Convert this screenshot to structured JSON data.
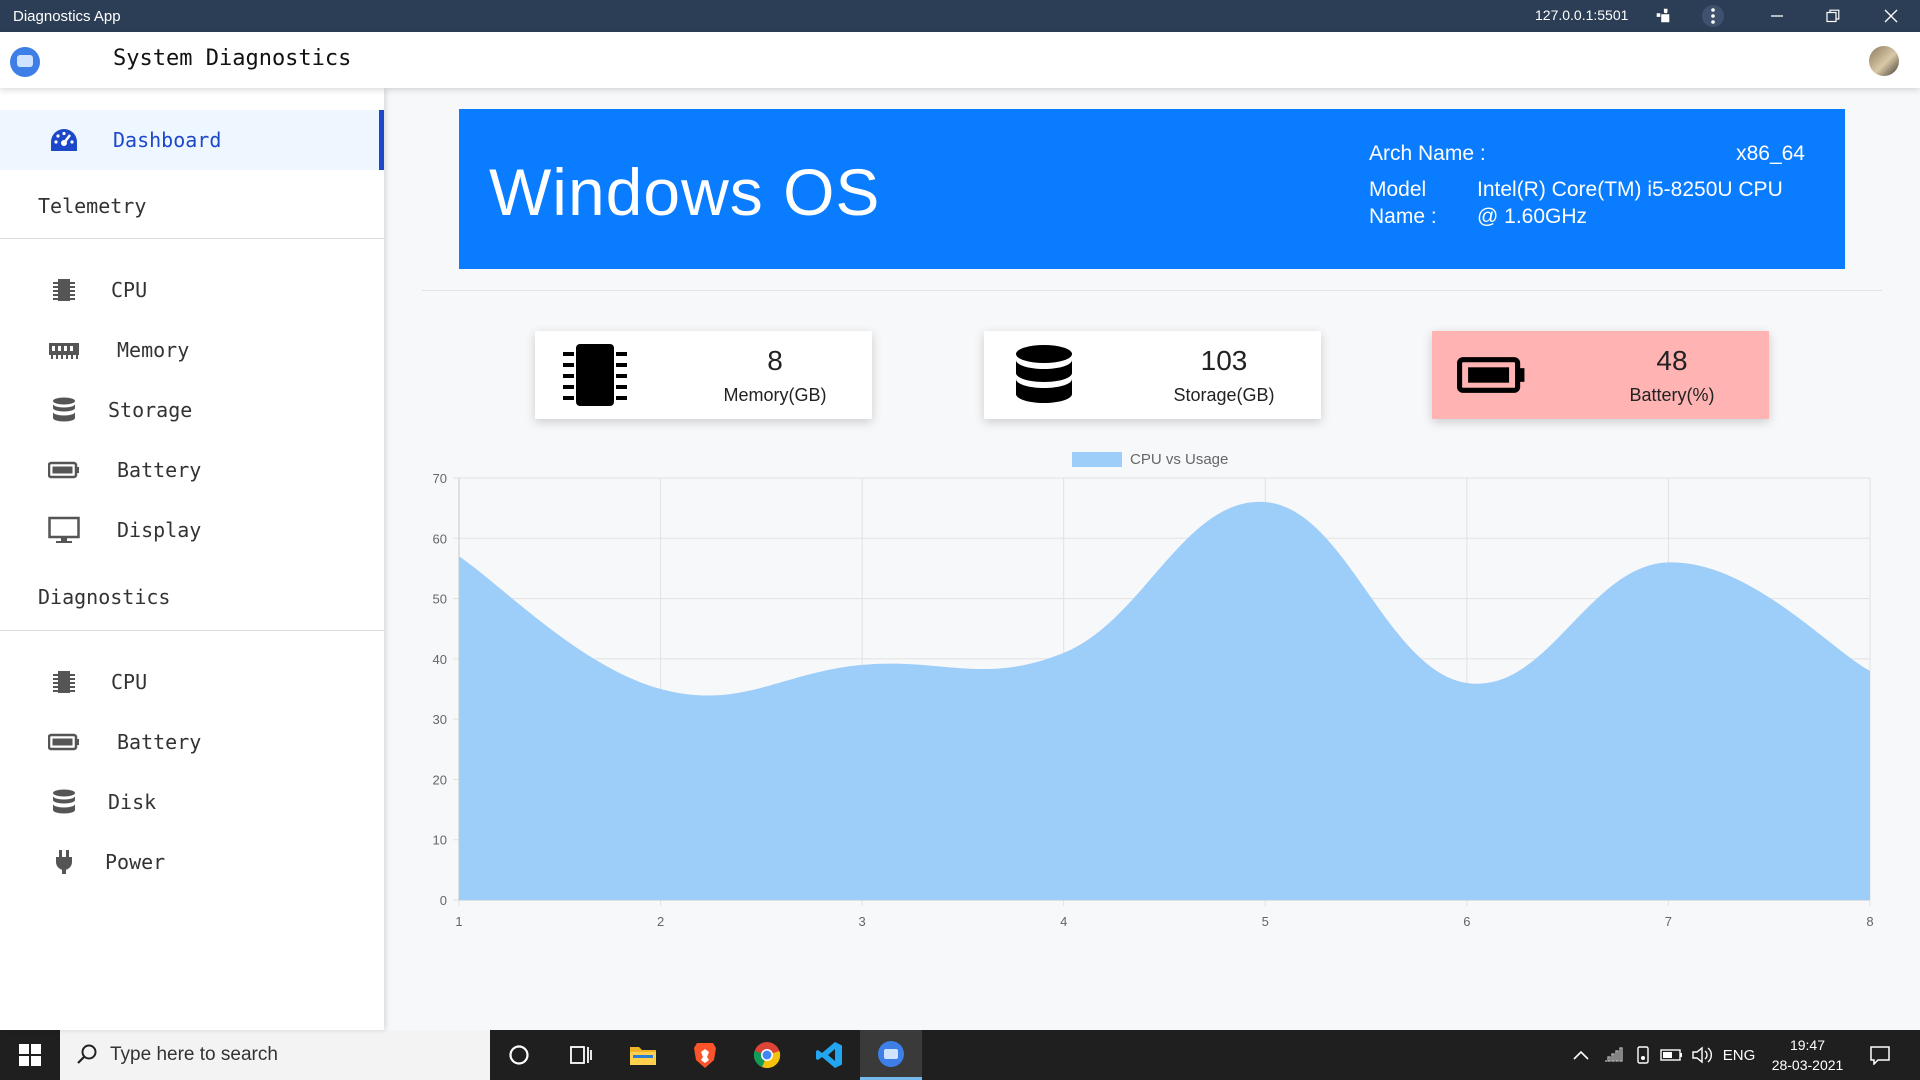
{
  "titlebar": {
    "title": "Diagnostics App",
    "url": "127.0.0.1:5501"
  },
  "app": {
    "title": "System Diagnostics"
  },
  "sidebar": {
    "dashboard_label": "Dashboard",
    "telemetry_heading": "Telemetry",
    "telemetry_items": [
      {
        "label": "CPU",
        "icon": "chip-icon"
      },
      {
        "label": "Memory",
        "icon": "memory-icon"
      },
      {
        "label": "Storage",
        "icon": "database-icon"
      },
      {
        "label": "Battery",
        "icon": "battery-icon"
      },
      {
        "label": "Display",
        "icon": "monitor-icon"
      }
    ],
    "diagnostics_heading": "Diagnostics",
    "diagnostics_items": [
      {
        "label": "CPU",
        "icon": "chip-icon"
      },
      {
        "label": "Battery",
        "icon": "battery-icon"
      },
      {
        "label": "Disk",
        "icon": "database-icon"
      },
      {
        "label": "Power",
        "icon": "plug-icon"
      }
    ]
  },
  "banner": {
    "os": "Windows OS",
    "arch_label": "Arch Name :",
    "arch_value": "x86_64",
    "model_label_1": "Model",
    "model_label_2": "Name :",
    "model_value_1": "Intel(R) Core(TM) i5-8250U CPU",
    "model_value_2": "@ 1.60GHz",
    "color": "#0a7cff"
  },
  "cards": [
    {
      "value": "8",
      "label": "Memory(GB)",
      "icon": "chip-icon"
    },
    {
      "value": "103",
      "label": "Storage(GB)",
      "icon": "database-icon"
    },
    {
      "value": "48",
      "label": "Battery(%)",
      "icon": "battery-icon",
      "color": "#ffb3b3"
    }
  ],
  "chart_data": {
    "type": "area",
    "legend": "CPU vs Usage",
    "x": [
      1,
      2,
      3,
      4,
      5,
      6,
      7,
      8
    ],
    "values": [
      57,
      35,
      39,
      41,
      66,
      36,
      56,
      38
    ],
    "ylim": [
      0,
      70
    ],
    "yticks": [
      0,
      10,
      20,
      30,
      40,
      50,
      60,
      70
    ],
    "fill_color": "#9dcdf9",
    "grid": true,
    "legend_position": "top-center"
  },
  "taskbar": {
    "search_placeholder": "Type here to search",
    "lang": "ENG",
    "time": "19:47",
    "date": "28-03-2021"
  }
}
